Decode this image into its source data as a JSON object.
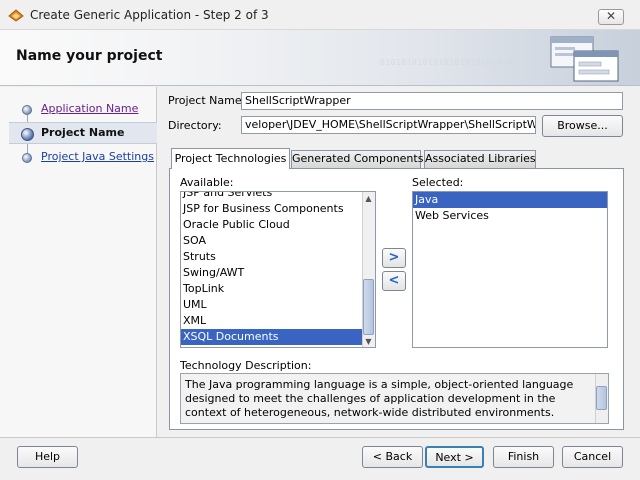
{
  "window": {
    "title": "Create Generic Application - Step 2 of 3",
    "close_glyph": "✕"
  },
  "banner": {
    "title": "Name your project",
    "decoration": "01010101010101010101010101",
    "graphic_icon": "dialog-windows-icon"
  },
  "steps": [
    {
      "label": "Application Name"
    },
    {
      "label": "Project Name"
    },
    {
      "label": "Project Java Settings"
    }
  ],
  "form": {
    "project_name_label": "Project Name:",
    "project_name_value": "ShellScriptWrapper",
    "directory_label": "Directory:",
    "directory_value": "veloper\\JDEV_HOME\\ShellScriptWrapper\\ShellScriptWrapper",
    "browse_label": "Browse..."
  },
  "tabs": [
    {
      "label": "Project Technologies",
      "selected": true
    },
    {
      "label": "Generated Components",
      "selected": false
    },
    {
      "label": "Associated Libraries",
      "selected": false
    }
  ],
  "available": {
    "label": "Available:",
    "items": [
      "JSP and Servlets",
      "JSP for Business Components",
      "Oracle Public Cloud",
      "SOA",
      "Struts",
      "Swing/AWT",
      "TopLink",
      "UML",
      "XML",
      "XSQL Documents"
    ],
    "selected": "XSQL Documents"
  },
  "selected": {
    "label": "Selected:",
    "items": [
      "Java",
      "Web Services"
    ],
    "selected": "Java"
  },
  "shuttle": {
    "add": ">",
    "remove": "<"
  },
  "description": {
    "label": "Technology Description:",
    "text": "The Java programming language is a simple, object-oriented language designed to meet the challenges of application development in the context of heterogeneous, network-wide distributed environments."
  },
  "buttons": {
    "help": "Help",
    "back": "< Back",
    "next": "Next >",
    "finish": "Finish",
    "cancel": "Cancel"
  },
  "colors": {
    "selection": "#3a64c2",
    "visited_link": "#681f8d",
    "link": "#1a3fa0"
  }
}
